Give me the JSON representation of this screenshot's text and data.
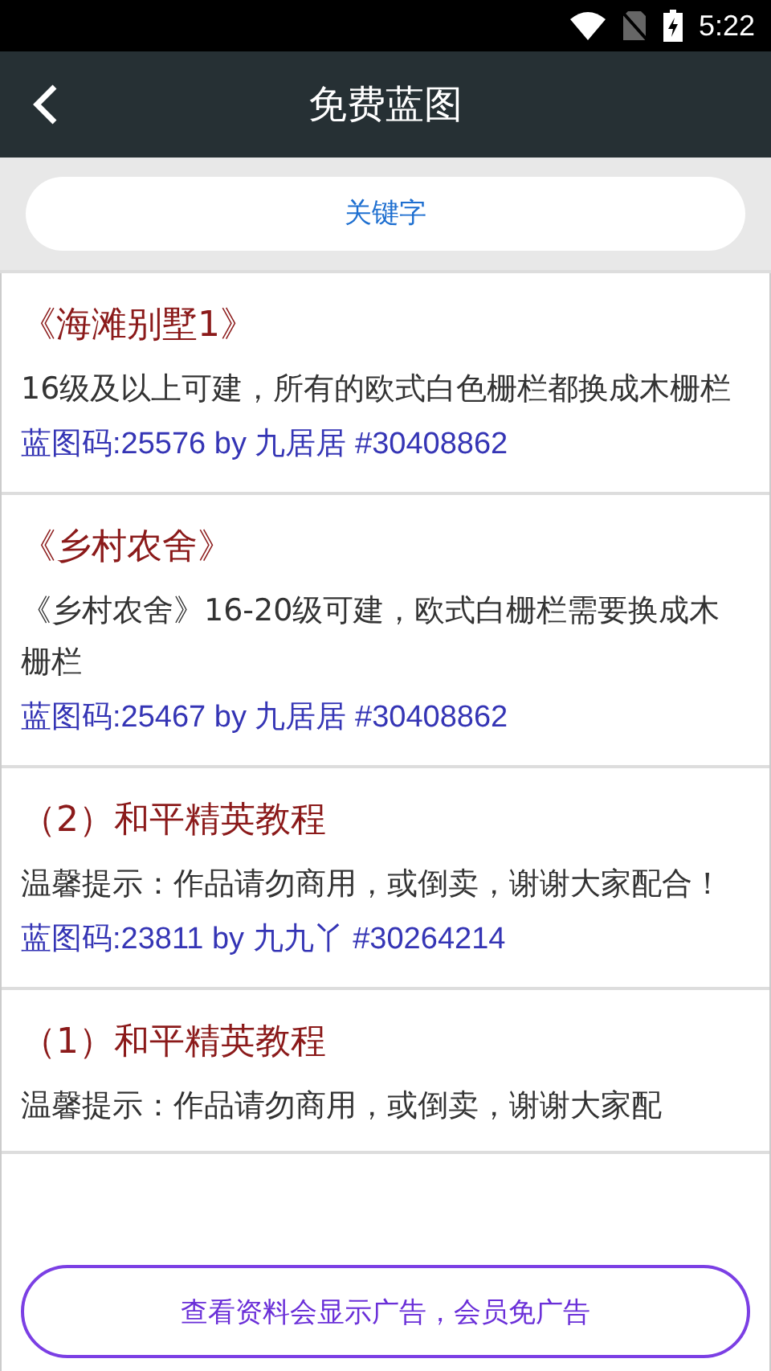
{
  "status_bar": {
    "time": "5:22"
  },
  "header": {
    "title": "免费蓝图"
  },
  "search": {
    "placeholder": "关键字"
  },
  "items": [
    {
      "title": "《海滩别墅1》",
      "description": "16级及以上可建，所有的欧式白色栅栏都换成木栅栏",
      "code": "蓝图码:25576 by 九居居 #30408862"
    },
    {
      "title": "《乡村农舍》",
      "description": "《乡村农舍》16-20级可建，欧式白栅栏需要换成木栅栏",
      "code": "蓝图码:25467 by 九居居 #30408862"
    },
    {
      "title": "（2）和平精英教程",
      "description": "温馨提示：作品请勿商用，或倒卖，谢谢大家配合！",
      "code": "蓝图码:23811 by 九九丫 #30264214"
    },
    {
      "title": "（1）和平精英教程",
      "description": "温馨提示：作品请勿商用，或倒卖，谢谢大家配"
    }
  ],
  "ad_button": "查看资料会显示广告，会员免广告"
}
